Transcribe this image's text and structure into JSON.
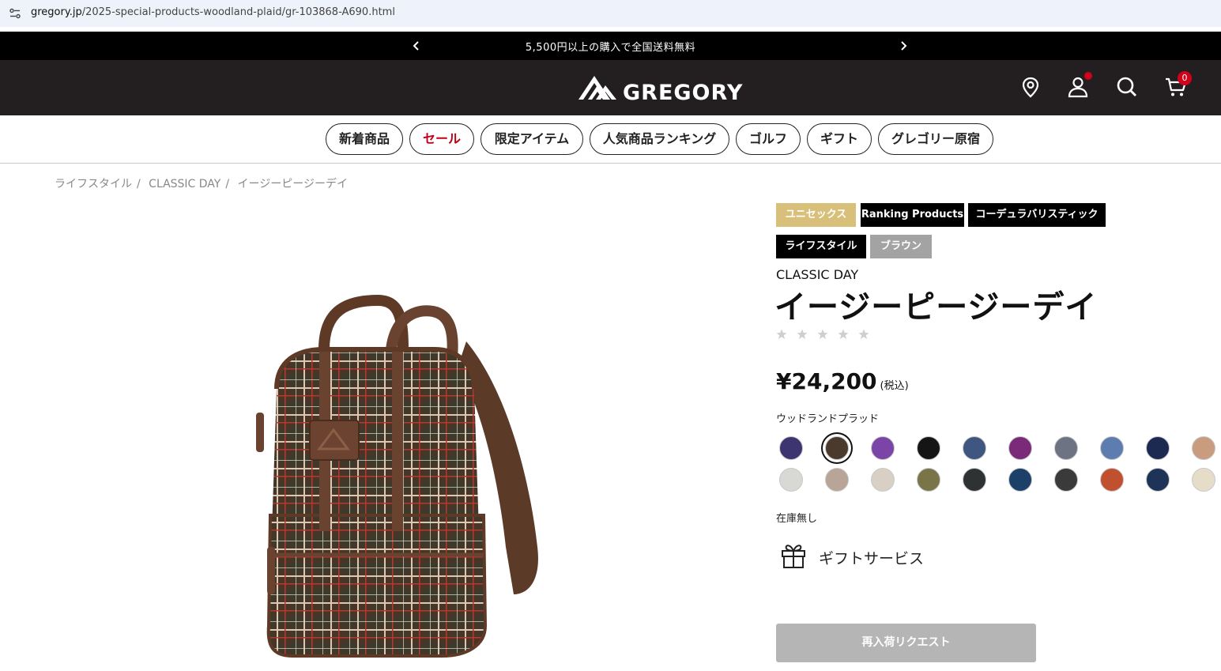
{
  "browser": {
    "url_host": "gregory.jp",
    "url_path": "/2025-special-products-woodland-plaid/gr-103868-A690.html"
  },
  "promo": {
    "message": "5,500円以上の購入で全国送料無料",
    "prev_icon": "chevron-left-icon",
    "next_icon": "chevron-right-icon"
  },
  "header": {
    "logo_text": "GREGORY",
    "icons": [
      "store-locator-icon",
      "account-icon",
      "search-icon",
      "cart-icon"
    ],
    "cart_count": "0",
    "accent_color": "#d0021b",
    "background": "#231f20"
  },
  "nav": {
    "items": [
      "新着商品",
      "セール",
      "限定アイテム",
      "人気商品ランキング",
      "ゴルフ",
      "ギフト",
      "グレゴリー原宿"
    ],
    "sale_color": "#c0001a"
  },
  "breadcrumb": [
    "ライフスタイル",
    "CLASSIC DAY",
    "イージーピージーデイ"
  ],
  "product": {
    "tags": [
      {
        "label": "ユニセックス",
        "color": "#d8c07a"
      },
      {
        "label": "Ranking Products",
        "color": "#000000"
      },
      {
        "label": "コーデュラバリスティック",
        "color": "#000000"
      },
      {
        "label": "ライフスタイル",
        "color": "#000000"
      },
      {
        "label": "ブラウン",
        "color": "#a3a3a3"
      }
    ],
    "collection": "CLASSIC DAY",
    "name": "イージーピージーデイ",
    "rating": 0,
    "rating_max": 5,
    "price": "¥24,200",
    "tax_note": "(税込)",
    "selected_color": "ウッドランドプラッド",
    "swatches": [
      [
        "#3d3570",
        "#4a3a2e",
        "#7b45a8",
        "#151515",
        "#3f5680",
        "#7a2a78",
        "#6e7384",
        "#5d7cb0",
        "#1c2a52",
        "#c99c80"
      ],
      [
        "#d8d8d4",
        "#b8a598",
        "#d8d0c4",
        "#7a7548",
        "#2e3232",
        "#1d4068",
        "#3a3a3a",
        "#c0502e",
        "#1e3358",
        "#e6ddc8"
      ]
    ],
    "selected_swatch_index": 1,
    "stock_status": "在庫無し",
    "gift_label": "ギフトサービス",
    "restock_button": "再入荷リクエスト"
  }
}
